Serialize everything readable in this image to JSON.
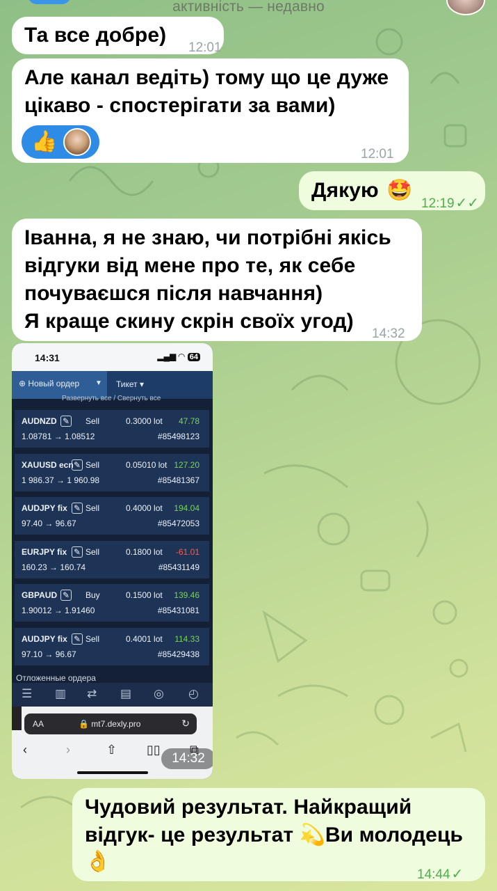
{
  "header": {
    "status": "активність — недавно"
  },
  "messages": [
    {
      "id": 1,
      "direction": "in",
      "text": "Та все добре)",
      "time": "12:01"
    },
    {
      "id": 2,
      "direction": "in",
      "text_lines": [
        "Але канал ведіть) тому що це дуже",
        "цікаво - спостерігати за вами)"
      ],
      "time": "12:01",
      "reaction_emoji": "👍"
    },
    {
      "id": 3,
      "direction": "out",
      "text": "Дякую",
      "emoji": "🤩",
      "time": "12:19",
      "read": true
    },
    {
      "id": 4,
      "direction": "in",
      "text_lines": [
        "Іванна, я не знаю, чи потрібні якісь",
        "відгуки від мене про те, як себе",
        "почуваєшся після навчання)",
        "Я краще скину скрін своїх угод)"
      ],
      "time": "14:32"
    },
    {
      "id": 5,
      "direction": "in",
      "type": "image",
      "time": "14:32"
    },
    {
      "id": 6,
      "direction": "out",
      "text_lines": [
        "Чудовий результат. Найкращий",
        "відгук- це результат",
        "Ви молодець"
      ],
      "emoji_mid": "💫",
      "emoji_end": "👌",
      "time": "14:44",
      "read": true
    }
  ],
  "screenshot": {
    "clock": "14:31",
    "battery": "64",
    "new_order_label": "Новый ордер",
    "ticket_label": "Тикет",
    "expand_label": "Развернуть все / Свернуть все",
    "orders": [
      {
        "symbol": "AUDNZD",
        "side": "Sell",
        "lot": "0.3000 lot",
        "pnl": "47.78",
        "pnl_sign": "pos",
        "price": "1.08781 → 1.08512",
        "ticket": "#85498123"
      },
      {
        "symbol": "XAUUSD ecn",
        "side": "Sell",
        "lot": "0.05010 lot",
        "pnl": "127.20",
        "pnl_sign": "pos",
        "price": "1 986.37 → 1 960.98",
        "ticket": "#85481367"
      },
      {
        "symbol": "AUDJPY fix",
        "side": "Sell",
        "lot": "0.4000 lot",
        "pnl": "194.04",
        "pnl_sign": "pos",
        "price": "97.40 → 96.67",
        "ticket": "#85472053"
      },
      {
        "symbol": "EURJPY fix",
        "side": "Sell",
        "lot": "0.1800 lot",
        "pnl": "-61.01",
        "pnl_sign": "neg",
        "price": "160.23 → 160.74",
        "ticket": "#85431149"
      },
      {
        "symbol": "GBPAUD",
        "side": "Buy",
        "lot": "0.1500 lot",
        "pnl": "139.46",
        "pnl_sign": "pos",
        "price": "1.90012 → 1.91460",
        "ticket": "#85431081"
      },
      {
        "symbol": "AUDJPY fix",
        "side": "Sell",
        "lot": "0.4001 lot",
        "pnl": "114.33",
        "pnl_sign": "pos",
        "price": "97.10 → 96.67",
        "ticket": "#85429438"
      }
    ],
    "pending_label": "Отложенные ордера",
    "url_aa": "AA",
    "url": "mt7.dexly.pro"
  },
  "colors": {
    "incoming_bubble": "#ffffff",
    "outgoing_bubble": "#effdde",
    "reaction_pill": "#2e8be6",
    "timestamp_out": "#4fae4e",
    "profit": "#7bd25c",
    "loss": "#ff5a4e"
  }
}
